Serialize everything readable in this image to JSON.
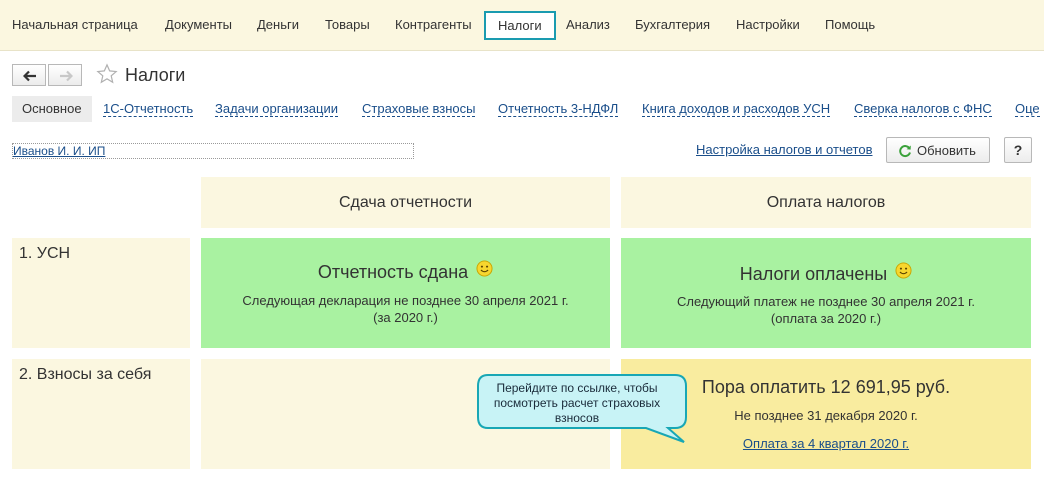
{
  "topnav": {
    "items": [
      {
        "label": "Начальная страница"
      },
      {
        "label": "Документы"
      },
      {
        "label": "Деньги"
      },
      {
        "label": "Товары"
      },
      {
        "label": "Контрагенты"
      },
      {
        "label": "Налоги",
        "active": true
      },
      {
        "label": "Анализ"
      },
      {
        "label": "Бухгалтерия"
      },
      {
        "label": "Настройки"
      },
      {
        "label": "Помощь"
      }
    ]
  },
  "header": {
    "title": "Налоги",
    "back_icon": "arrow-left-icon",
    "forward_icon": "arrow-right-icon",
    "favorite_icon": "star-icon"
  },
  "tabs": [
    {
      "label": "Основное",
      "active": true
    },
    {
      "label": "1С-Отчетность"
    },
    {
      "label": "Задачи организации"
    },
    {
      "label": "Страховые взносы"
    },
    {
      "label": "Отчетность 3-НДФЛ"
    },
    {
      "label": "Книга доходов и расходов УСН"
    },
    {
      "label": "Сверка налогов с ФНС"
    },
    {
      "label": "Оце"
    }
  ],
  "controls": {
    "organization": "Иванов И. И. ИП",
    "settings_link": "Настройка налогов и отчетов",
    "refresh_label": "Обновить",
    "help_label": "?"
  },
  "grid": {
    "col_reporting": "Сдача отчетности",
    "col_payment": "Оплата налогов",
    "rows": [
      {
        "label": "1. УСН",
        "reporting": {
          "title": "Отчетность сдана",
          "line1": "Следующая декларация не позднее 30 апреля 2021 г.",
          "line2": "(за 2020 г.)",
          "status_color": "#a9f2a1"
        },
        "payment": {
          "title": "Налоги оплачены",
          "line1": "Следующий платеж не позднее 30 апреля 2021 г.",
          "line2": "(оплата за 2020 г.)",
          "status_color": "#a9f2a1"
        }
      },
      {
        "label": "2. Взносы за себя",
        "payment": {
          "title": "Пора оплатить 12 691,95 руб.",
          "line1": "Не позднее 31 декабря 2020 г.",
          "link": "Оплата за 4 квартал 2020 г.",
          "status_color": "#f9ec9f"
        }
      }
    ]
  },
  "tooltip": {
    "text": "Перейдите по ссылке, чтобы посмотреть расчет страховых взносов"
  },
  "colors": {
    "accent": "#1a9bb0",
    "link": "#1a4e8a",
    "header_bg": "#fbf7e0",
    "ok_bg": "#a9f2a1",
    "due_bg": "#f9ec9f"
  }
}
